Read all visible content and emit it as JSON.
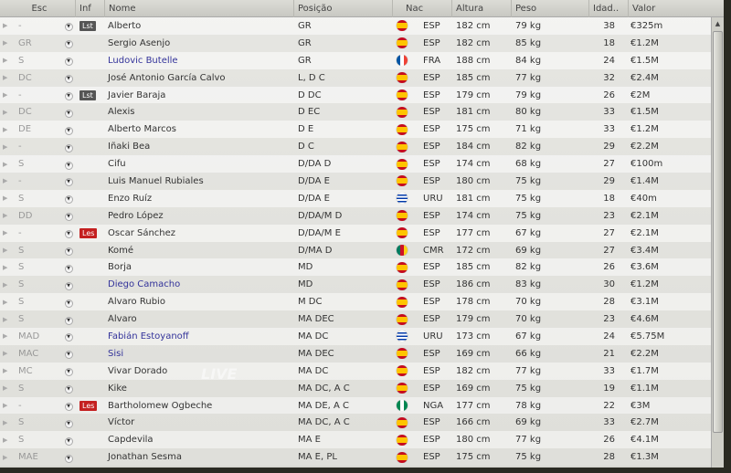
{
  "columns": [
    "Esc",
    "Inf",
    "Nome",
    "Posição",
    "Nac",
    "Altura",
    "Peso",
    "Idad..",
    "Valor"
  ],
  "flag_colors": {
    "ESP": [
      "#c60b1e",
      "#ffc400"
    ],
    "FRA": [
      "#0055a4",
      "#ffffff",
      "#ef4135"
    ],
    "URU": [
      "#ffffff",
      "#0038a8"
    ],
    "CMR": [
      "#007a5e",
      "#ce1126",
      "#fcd116"
    ],
    "NGA": [
      "#008751",
      "#ffffff"
    ]
  },
  "badge_colors": {
    "Lst": "#555555",
    "Les": "#c42020"
  },
  "rows": [
    {
      "esc": "-",
      "inf": "Lst",
      "nome": "Alberto",
      "pos": "GR",
      "nac": "ESP",
      "alt": "182 cm",
      "peso": "79 kg",
      "age": "38",
      "val": "€325m"
    },
    {
      "esc": "GR",
      "inf": "",
      "nome": "Sergio Asenjo",
      "pos": "GR",
      "nac": "ESP",
      "alt": "182 cm",
      "peso": "85 kg",
      "age": "18",
      "val": "€1.2M"
    },
    {
      "esc": "S",
      "inf": "",
      "nome": "Ludovic Butelle",
      "pos": "GR",
      "nac": "FRA",
      "alt": "188 cm",
      "peso": "84 kg",
      "age": "24",
      "val": "€1.5M",
      "blue": true
    },
    {
      "esc": "DC",
      "inf": "",
      "nome": "José Antonio García Calvo",
      "pos": "L, D C",
      "nac": "ESP",
      "alt": "185 cm",
      "peso": "77 kg",
      "age": "32",
      "val": "€2.4M"
    },
    {
      "esc": "-",
      "inf": "Lst",
      "nome": "Javier Baraja",
      "pos": "D DC",
      "nac": "ESP",
      "alt": "179 cm",
      "peso": "79 kg",
      "age": "26",
      "val": "€2M"
    },
    {
      "esc": "DC",
      "inf": "",
      "nome": "Alexis",
      "pos": "D EC",
      "nac": "ESP",
      "alt": "181 cm",
      "peso": "80 kg",
      "age": "33",
      "val": "€1.5M"
    },
    {
      "esc": "DE",
      "inf": "",
      "nome": "Alberto Marcos",
      "pos": "D E",
      "nac": "ESP",
      "alt": "175 cm",
      "peso": "71 kg",
      "age": "33",
      "val": "€1.2M"
    },
    {
      "esc": "-",
      "inf": "",
      "nome": "Iñaki Bea",
      "pos": "D C",
      "nac": "ESP",
      "alt": "184 cm",
      "peso": "82 kg",
      "age": "29",
      "val": "€2.2M"
    },
    {
      "esc": "S",
      "inf": "",
      "nome": "Cifu",
      "pos": "D/DA D",
      "nac": "ESP",
      "alt": "174 cm",
      "peso": "68 kg",
      "age": "27",
      "val": "€100m"
    },
    {
      "esc": "-",
      "inf": "",
      "nome": "Luis Manuel Rubiales",
      "pos": "D/DA E",
      "nac": "ESP",
      "alt": "180 cm",
      "peso": "75 kg",
      "age": "29",
      "val": "€1.4M"
    },
    {
      "esc": "S",
      "inf": "",
      "nome": "Enzo Ruíz",
      "pos": "D/DA E",
      "nac": "URU",
      "alt": "181 cm",
      "peso": "75 kg",
      "age": "18",
      "val": "€40m"
    },
    {
      "esc": "DD",
      "inf": "",
      "nome": "Pedro López",
      "pos": "D/DA/M D",
      "nac": "ESP",
      "alt": "174 cm",
      "peso": "75 kg",
      "age": "23",
      "val": "€2.1M"
    },
    {
      "esc": "-",
      "inf": "Les",
      "nome": "Óscar Sánchez",
      "pos": "D/DA/M E",
      "nac": "ESP",
      "alt": "177 cm",
      "peso": "67 kg",
      "age": "27",
      "val": "€2.1M"
    },
    {
      "esc": "S",
      "inf": "",
      "nome": "Komé",
      "pos": "D/MA D",
      "nac": "CMR",
      "alt": "172 cm",
      "peso": "69 kg",
      "age": "27",
      "val": "€3.4M"
    },
    {
      "esc": "S",
      "inf": "",
      "nome": "Borja",
      "pos": "MD",
      "nac": "ESP",
      "alt": "185 cm",
      "peso": "82 kg",
      "age": "26",
      "val": "€3.6M"
    },
    {
      "esc": "S",
      "inf": "",
      "nome": "Diego Camacho",
      "pos": "MD",
      "nac": "ESP",
      "alt": "186 cm",
      "peso": "83 kg",
      "age": "30",
      "val": "€1.2M",
      "blue": true
    },
    {
      "esc": "S",
      "inf": "",
      "nome": "Álvaro Rubio",
      "pos": "M DC",
      "nac": "ESP",
      "alt": "178 cm",
      "peso": "70 kg",
      "age": "28",
      "val": "€3.1M"
    },
    {
      "esc": "S",
      "inf": "",
      "nome": "Álvaro",
      "pos": "MA DEC",
      "nac": "ESP",
      "alt": "179 cm",
      "peso": "70 kg",
      "age": "23",
      "val": "€4.6M"
    },
    {
      "esc": "MAD",
      "inf": "",
      "nome": "Fabián Estoyanoff",
      "pos": "MA DC",
      "nac": "URU",
      "alt": "173 cm",
      "peso": "67 kg",
      "age": "24",
      "val": "€5.75M",
      "blue": true
    },
    {
      "esc": "MAC",
      "inf": "",
      "nome": "Sisi",
      "pos": "MA DEC",
      "nac": "ESP",
      "alt": "169 cm",
      "peso": "66 kg",
      "age": "21",
      "val": "€2.2M",
      "blue": true
    },
    {
      "esc": "MC",
      "inf": "",
      "nome": "Vivar Dorado",
      "pos": "MA DC",
      "nac": "ESP",
      "alt": "182 cm",
      "peso": "77 kg",
      "age": "33",
      "val": "€1.7M"
    },
    {
      "esc": "S",
      "inf": "",
      "nome": "Kike",
      "pos": "MA DC, A C",
      "nac": "ESP",
      "alt": "169 cm",
      "peso": "75 kg",
      "age": "19",
      "val": "€1.1M"
    },
    {
      "esc": "-",
      "inf": "Les",
      "nome": "Bartholomew Ogbeche",
      "pos": "MA DE, A C",
      "nac": "NGA",
      "alt": "177 cm",
      "peso": "78 kg",
      "age": "22",
      "val": "€3M"
    },
    {
      "esc": "S",
      "inf": "",
      "nome": "Víctor",
      "pos": "MA DC, A C",
      "nac": "ESP",
      "alt": "166 cm",
      "peso": "69 kg",
      "age": "33",
      "val": "€2.7M"
    },
    {
      "esc": "S",
      "inf": "",
      "nome": "Capdevila",
      "pos": "MA E",
      "nac": "ESP",
      "alt": "180 cm",
      "peso": "77 kg",
      "age": "26",
      "val": "€4.1M"
    },
    {
      "esc": "MAE",
      "inf": "",
      "nome": "Jonathan Sesma",
      "pos": "MA E, PL",
      "nac": "ESP",
      "alt": "175 cm",
      "peso": "75 kg",
      "age": "28",
      "val": "€1.3M"
    }
  ]
}
